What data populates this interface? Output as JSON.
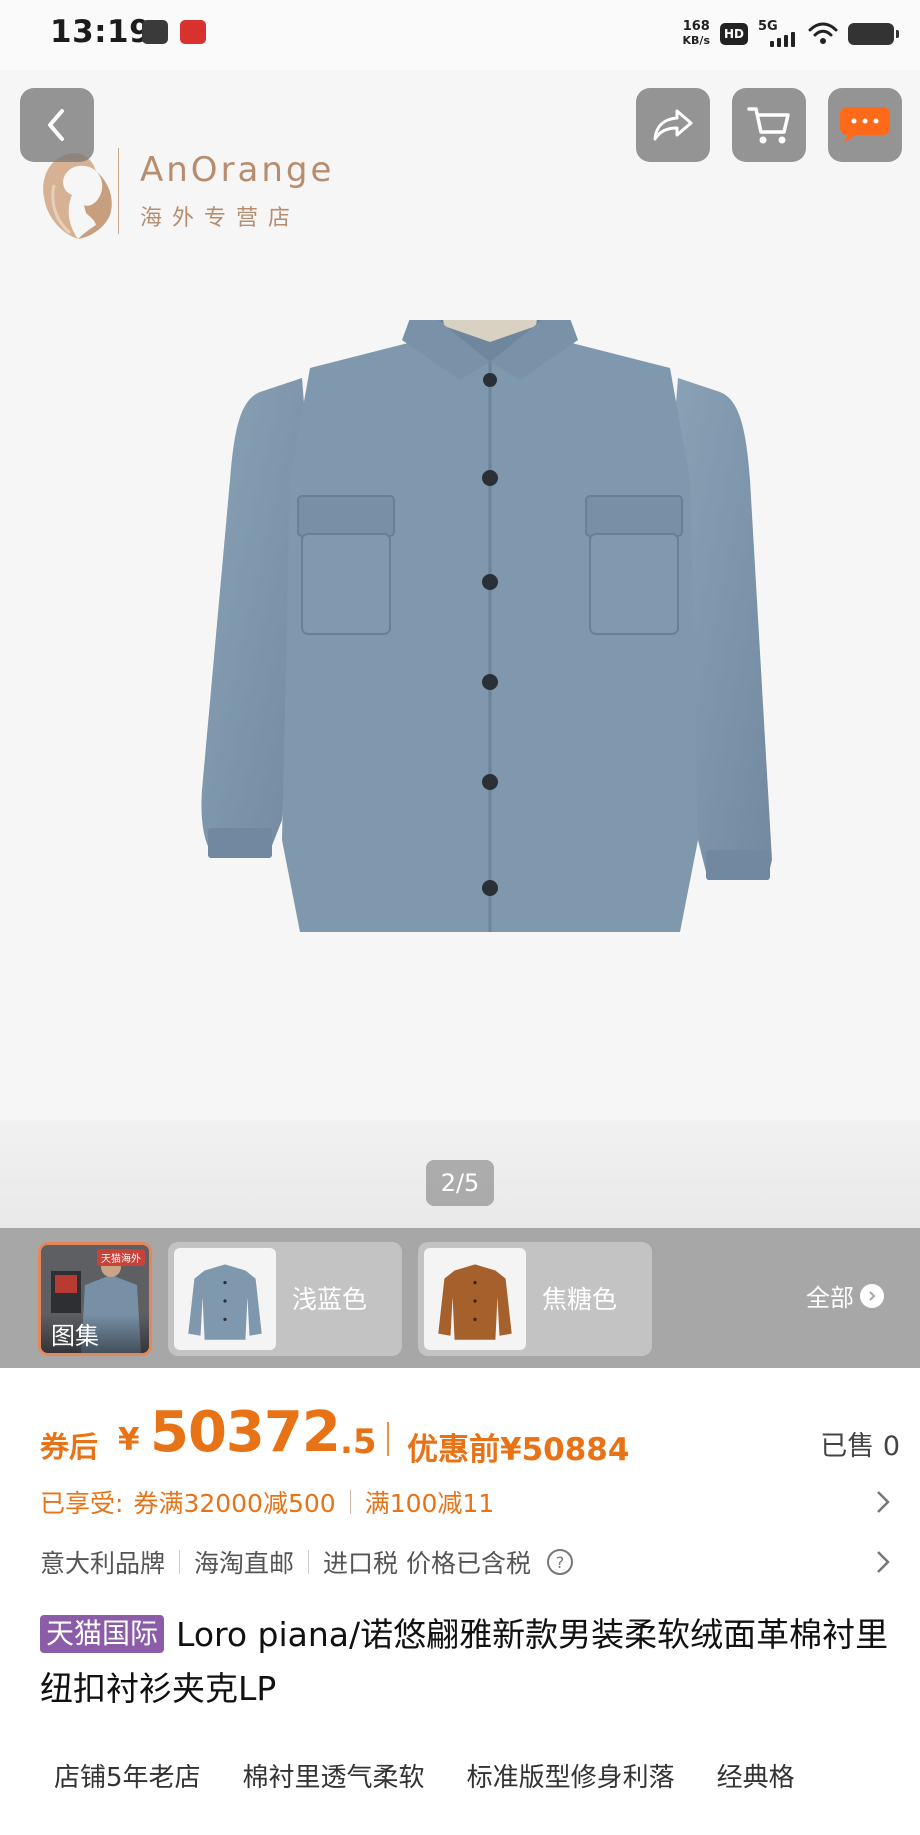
{
  "status_bar": {
    "time": "13:19",
    "net_speed_value": "168",
    "net_speed_unit": "KB/s",
    "hd_label": "HD",
    "network_label": "5G",
    "icons": [
      "message-icon",
      "app-notification-icon",
      "wifi-icon",
      "battery-icon"
    ]
  },
  "header": {
    "back_icon": "chevron-left-icon",
    "share_icon": "share-icon",
    "cart_icon": "cart-icon",
    "more_icon": "more-dots-icon",
    "accent_color": "#ff6a1a"
  },
  "brand": {
    "name": "AnOrange",
    "subtitle": "海外专营店"
  },
  "gallery": {
    "page_indicator": "2/5",
    "product_color": "#7f98ad"
  },
  "sku": {
    "gallery_label": "图集",
    "gallery_tag": "天猫海外",
    "options": [
      {
        "label": "浅蓝色",
        "swatch": "#7f98ad"
      },
      {
        "label": "焦糖色",
        "swatch": "#a6602c"
      }
    ],
    "all_label": "全部"
  },
  "price": {
    "prefix": "券后",
    "currency": "¥",
    "main": "50372",
    "decimal": ".5",
    "before_label": "优惠前¥50884",
    "sold_label": "已售 0",
    "color": "#e87317"
  },
  "promo": {
    "label": "已享受:",
    "items": [
      "券满32000减500",
      "满100减11"
    ]
  },
  "info": {
    "items": [
      "意大利品牌",
      "海淘直邮",
      "进口税 价格已含税"
    ]
  },
  "title": {
    "tag": "天猫国际",
    "text": "Loro piana/诺悠翩雅新款男装柔软绒面革棉衬里纽扣衬衫夹克LP",
    "tag_color": "#8b5ca8"
  },
  "features": [
    "店铺5年老店",
    "棉衬里透气柔软",
    "标准版型修身利落",
    "经典格"
  ]
}
